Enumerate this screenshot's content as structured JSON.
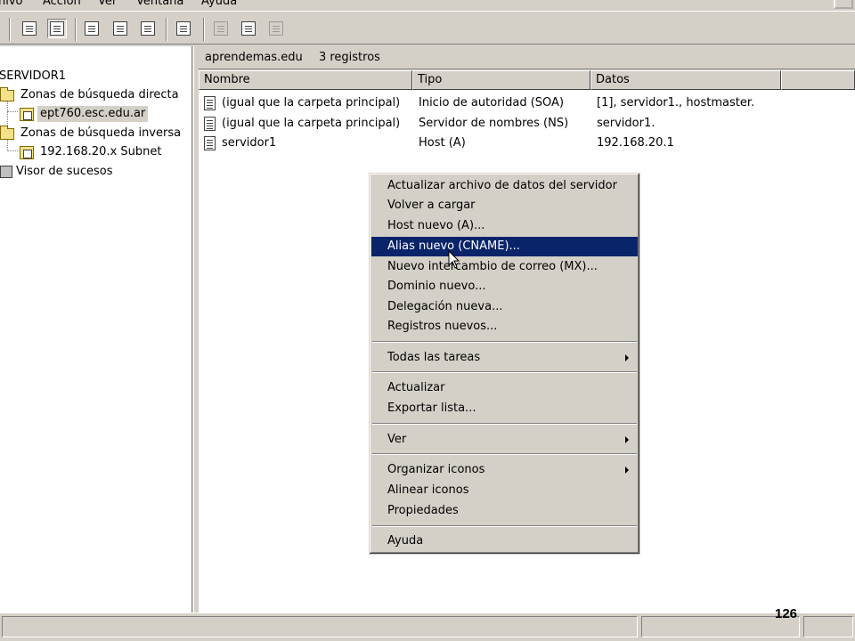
{
  "menubar": {
    "items": [
      "hivo",
      "Acción",
      "Ver",
      "Ventana",
      "Ayuda"
    ]
  },
  "toolbar": {
    "icons": [
      "up-folder-icon",
      "show-tree-icon",
      "properties-icon",
      "refresh-icon",
      "export-list-icon",
      "help-icon",
      "record-icon",
      "record-list-icon",
      "stack-icon"
    ]
  },
  "tree": {
    "root": "SERVIDOR1",
    "forward_zones": "Zonas de búsqueda directa",
    "forward_zone_child": "ept760.esc.edu.ar",
    "reverse_zones": "Zonas de búsqueda inversa",
    "reverse_zone_child": "192.168.20.x Subnet",
    "event_viewer": "Visor de sucesos"
  },
  "header": {
    "zone": "aprendemas.edu",
    "count": "3 registros"
  },
  "columns": [
    "Nombre",
    "Tipo",
    "Datos"
  ],
  "rows": [
    {
      "name": "(igual que la carpeta principal)",
      "type": "Inicio de autoridad (SOA)",
      "data": "[1], servidor1., hostmaster."
    },
    {
      "name": "(igual que la carpeta principal)",
      "type": "Servidor de nombres (NS)",
      "data": "servidor1."
    },
    {
      "name": "servidor1",
      "type": "Host (A)",
      "data": "192.168.20.1"
    }
  ],
  "context_menu": {
    "update_server_file": "Actualizar archivo de datos del servidor",
    "reload": "Volver a cargar",
    "new_host": "Host nuevo (A)...",
    "new_alias": "Alias nuevo (CNAME)...",
    "new_mx": "Nuevo intercambio de correo (MX)...",
    "new_domain": "Dominio nuevo...",
    "new_delegation": "Delegación nueva...",
    "new_records": "Registros nuevos...",
    "all_tasks": "Todas las tareas",
    "refresh": "Actualizar",
    "export_list": "Exportar lista...",
    "view": "Ver",
    "arrange_icons": "Organizar iconos",
    "line_up_icons": "Alinear iconos",
    "properties": "Propiedades",
    "help": "Ayuda"
  },
  "slide_number": "126"
}
